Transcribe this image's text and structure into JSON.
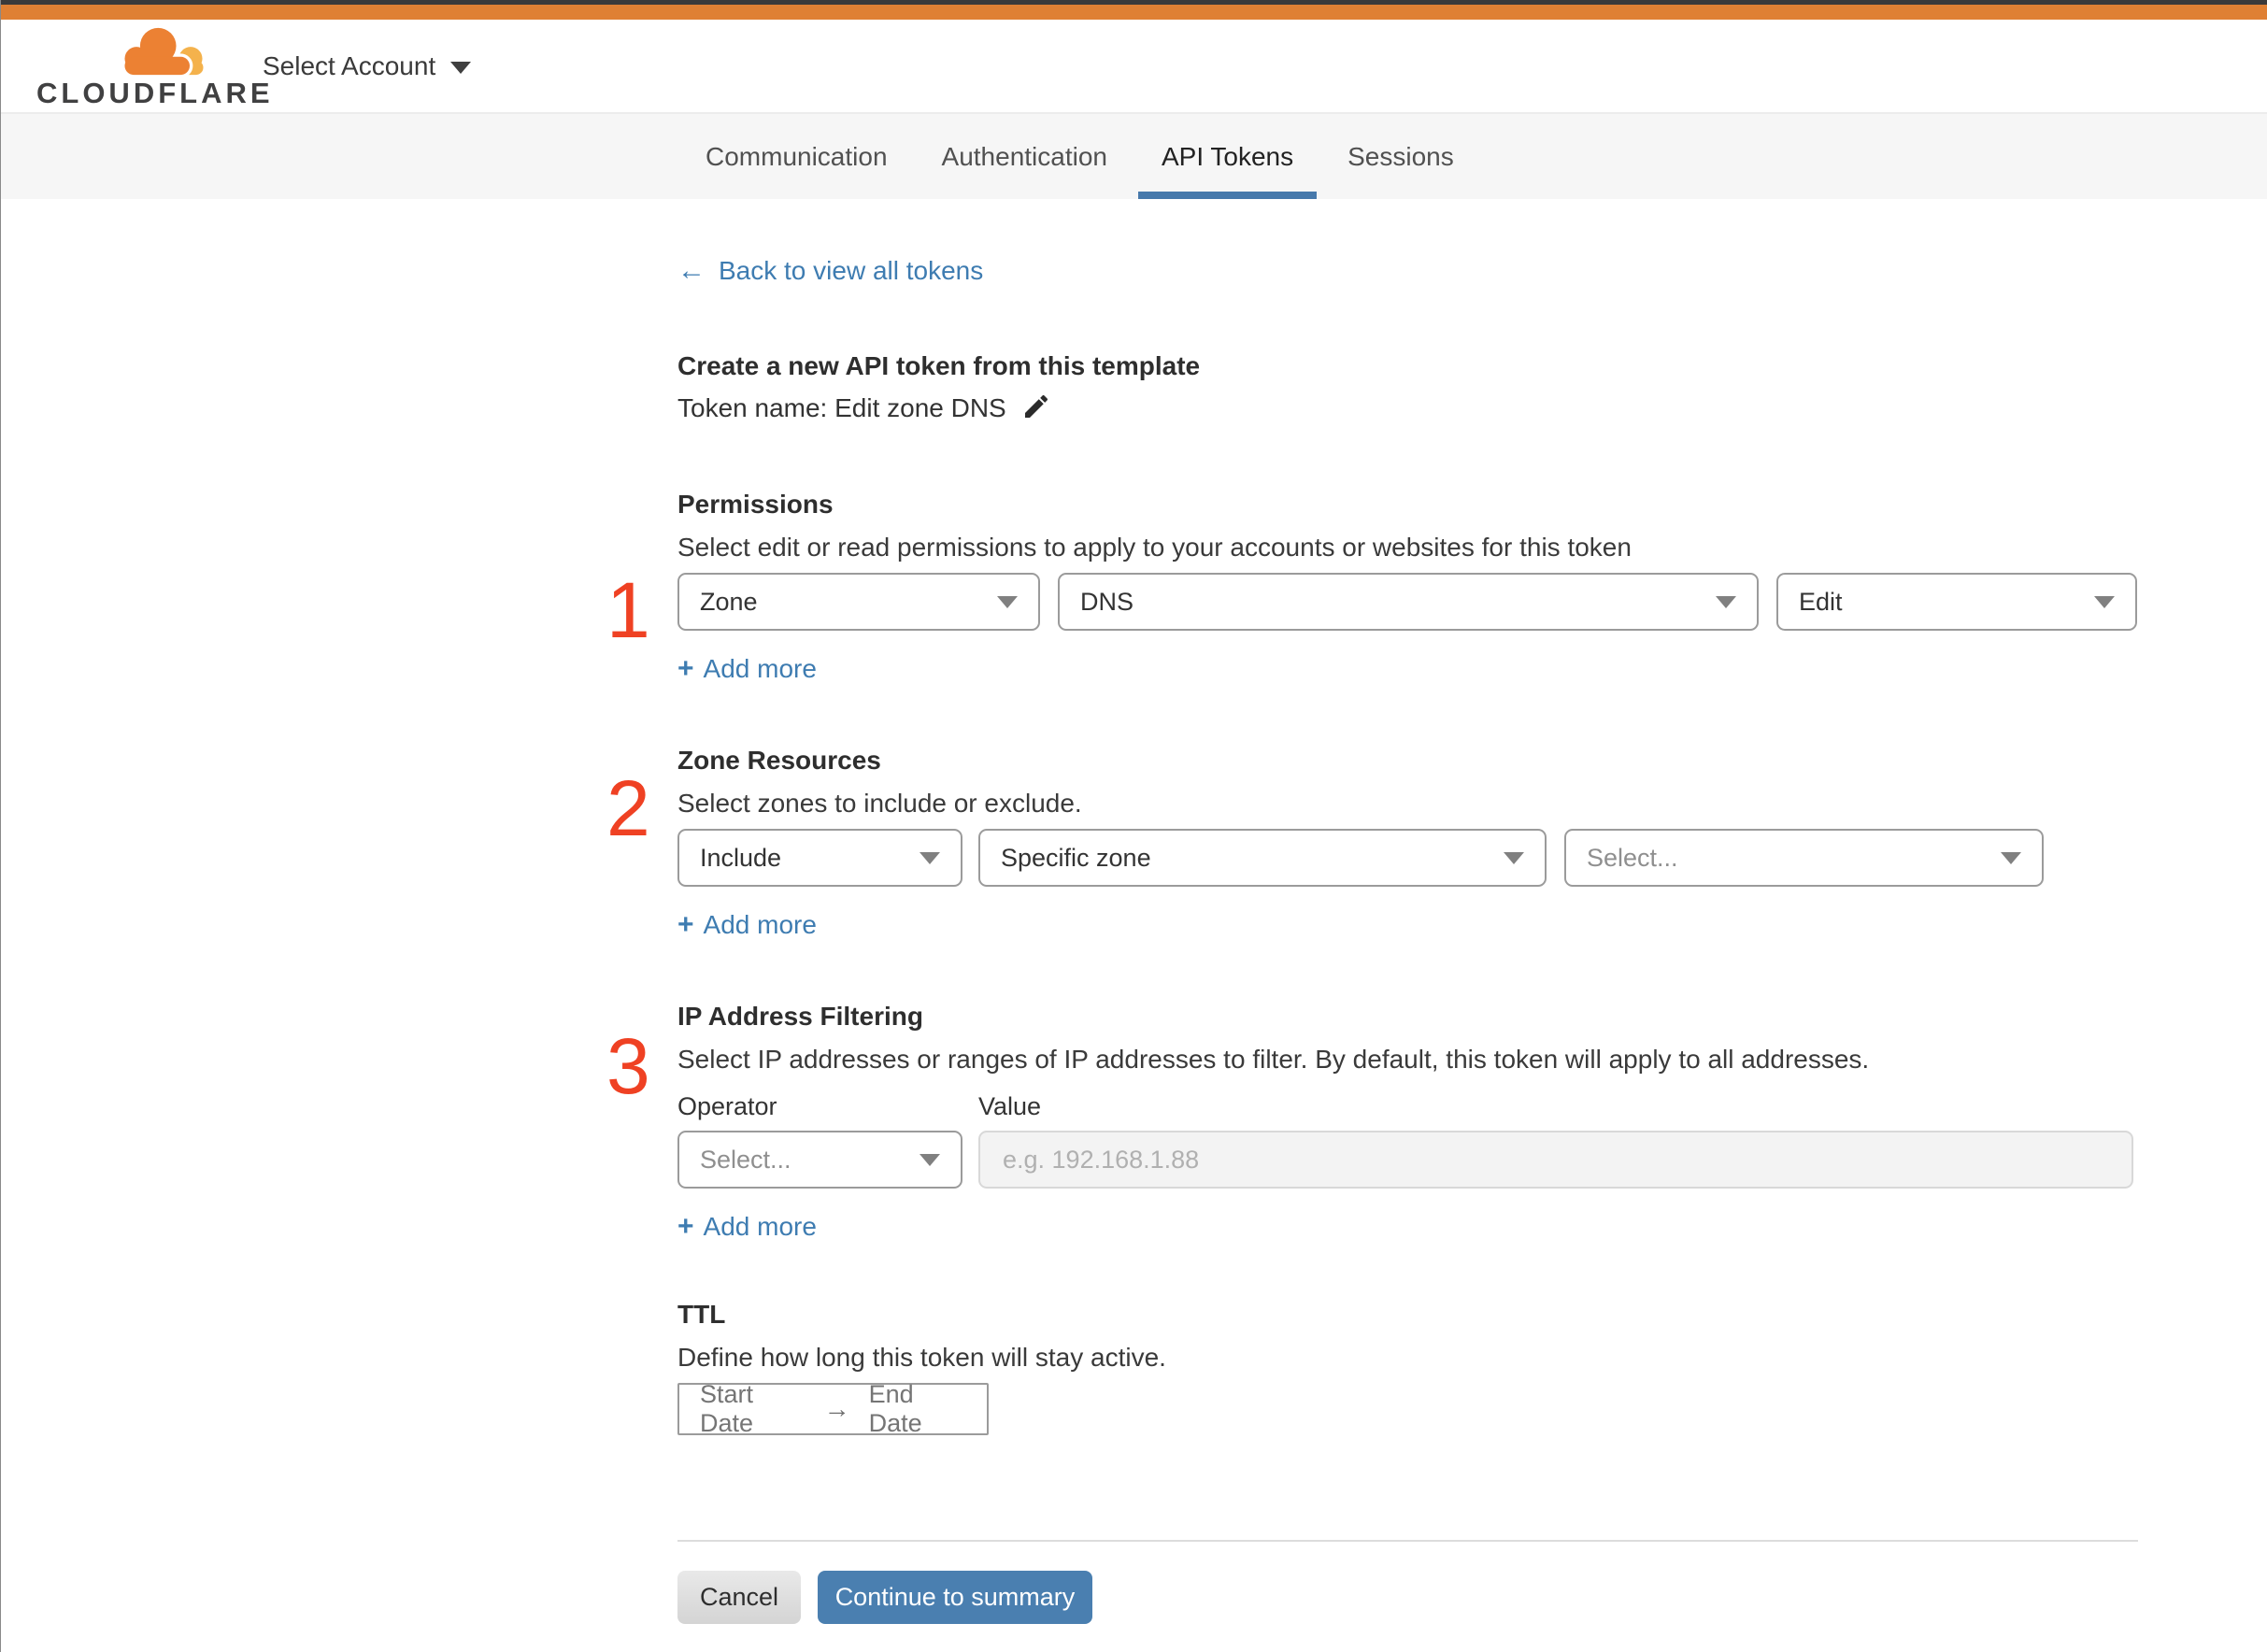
{
  "colors": {
    "top_bar_orange": "#df8034",
    "top_bar_dark": "#3a3a3b",
    "link_blue": "#3e7cb1",
    "active_tab_underline": "#4779ab",
    "primary_button_blue": "#4a7fb0",
    "annotation_red": "#ef4123",
    "logo_cloud_orange": "#ec8133",
    "logo_cloud_light": "#f4b24c"
  },
  "header": {
    "brand": "CLOUDFLARE",
    "account_selector": "Select Account"
  },
  "tabs": [
    {
      "label": "Communication",
      "active": false
    },
    {
      "label": "Authentication",
      "active": false
    },
    {
      "label": "API Tokens",
      "active": true
    },
    {
      "label": "Sessions",
      "active": false
    }
  ],
  "page": {
    "back_arrow": "←",
    "back_link": "Back to view all tokens"
  },
  "annotations": {
    "step1": "1",
    "step2": "2",
    "step3": "3"
  },
  "template_section": {
    "heading": "Create a new API token from this template",
    "token_name": "Token name: Edit zone DNS"
  },
  "permissions": {
    "heading": "Permissions",
    "description": "Select edit or read permissions to apply to your accounts or websites for this token",
    "scope_value": "Zone",
    "resource_value": "DNS",
    "access_value": "Edit",
    "add_more": "Add more"
  },
  "zone_resources": {
    "heading": "Zone Resources",
    "description": "Select zones to include or exclude.",
    "mode_value": "Include",
    "type_value": "Specific zone",
    "zone_value": "Select...",
    "add_more": "Add more"
  },
  "ip_filtering": {
    "heading": "IP Address Filtering",
    "description": "Select IP addresses or ranges of IP addresses to filter. By default, this token will apply to all addresses.",
    "operator_label": "Operator",
    "value_label": "Value",
    "operator_value": "Select...",
    "value_placeholder": "e.g. 192.168.1.88",
    "add_more": "Add more"
  },
  "ttl": {
    "heading": "TTL",
    "description": "Define how long this token will stay active.",
    "start_label": "Start Date",
    "arrow": "→",
    "end_label": "End Date"
  },
  "footer": {
    "cancel_label": "Cancel",
    "continue_label": "Continue to summary"
  },
  "icons": {
    "plus": "+"
  }
}
